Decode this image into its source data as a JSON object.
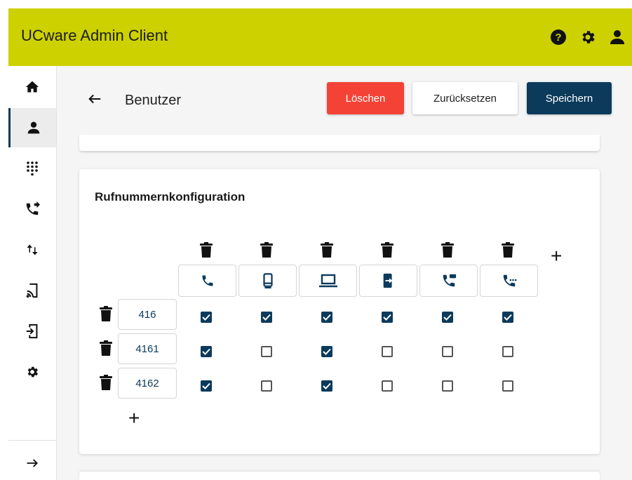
{
  "app": {
    "title": "UCware Admin Client"
  },
  "topbar_icons": [
    "help-icon",
    "gear-icon",
    "account-icon"
  ],
  "sidebar": {
    "items": [
      {
        "name": "home",
        "icon": "home-icon",
        "active": false
      },
      {
        "name": "users",
        "icon": "person-icon",
        "active": true
      },
      {
        "name": "dialpad",
        "icon": "dialpad-icon",
        "active": false
      },
      {
        "name": "call-forward",
        "icon": "phone-forward-icon",
        "active": false
      },
      {
        "name": "transfer",
        "icon": "swap-vertical-icon",
        "active": false
      },
      {
        "name": "cast",
        "icon": "cast-icon",
        "active": false
      },
      {
        "name": "device-login",
        "icon": "device-login-icon",
        "active": false
      },
      {
        "name": "settings",
        "icon": "gear-icon",
        "active": false
      }
    ],
    "expand_icon": "arrow-right-icon"
  },
  "header": {
    "title": "Benutzer",
    "delete_label": "Löschen",
    "reset_label": "Zurücksetzen",
    "save_label": "Speichern"
  },
  "colors": {
    "topbar": "#cdd100",
    "primary": "#0b3a5b",
    "danger": "#f44336"
  },
  "config": {
    "title": "Rufnummernkonfiguration",
    "devices": [
      {
        "type": "phone",
        "icon": "phone-icon"
      },
      {
        "type": "mobile",
        "icon": "mobile-icon"
      },
      {
        "type": "laptop",
        "icon": "laptop-icon"
      },
      {
        "type": "device-login",
        "icon": "device-login-icon"
      },
      {
        "type": "sip",
        "icon": "phone-sip-icon"
      },
      {
        "type": "phone-dots",
        "icon": "phone-dots-icon"
      }
    ],
    "rows": [
      {
        "number": "416",
        "checks": [
          true,
          true,
          true,
          true,
          true,
          true
        ]
      },
      {
        "number": "4161",
        "checks": [
          true,
          false,
          true,
          false,
          false,
          false
        ]
      },
      {
        "number": "4162",
        "checks": [
          true,
          false,
          true,
          false,
          false,
          false
        ]
      }
    ]
  }
}
